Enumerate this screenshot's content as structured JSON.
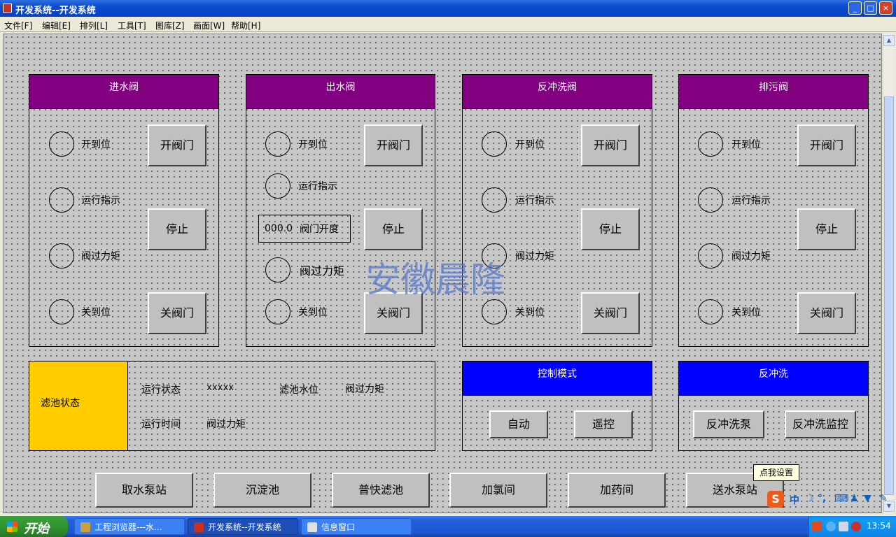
{
  "window": {
    "title": "开发系统--开发系统",
    "min": "_",
    "max": "□",
    "close": "×"
  },
  "menu": [
    "文件[F]",
    "编辑[E]",
    "排列[L]",
    "工具[T]",
    "图库[Z]",
    "画面[W]",
    "帮助[H]"
  ],
  "watermark": "安徽晨隆",
  "panels": [
    {
      "title": "进水阀",
      "open_ind": "开到位",
      "run_ind": "运行指示",
      "torque": "阀过力矩",
      "closed_ind": "关到位",
      "open_btn": "开阀门",
      "stop_btn": "停止",
      "close_btn": "关阀门"
    },
    {
      "title": "出水阀",
      "open_ind": "开到位",
      "run_ind": "运行指示",
      "opening_value": "000.0",
      "opening_label": "阀门开度",
      "torque": "阀过力矩",
      "closed_ind": "关到位",
      "open_btn": "开阀门",
      "stop_btn": "停止",
      "close_btn": "关阀门"
    },
    {
      "title": "反冲洗阀",
      "open_ind": "开到位",
      "run_ind": "运行指示",
      "torque": "阀过力矩",
      "closed_ind": "关到位",
      "open_btn": "开阀门",
      "stop_btn": "停止",
      "close_btn": "关阀门"
    },
    {
      "title": "排污阀",
      "open_ind": "开到位",
      "run_ind": "运行指示",
      "torque": "阀过力矩",
      "closed_ind": "关到位",
      "open_btn": "开阀门",
      "stop_btn": "停止",
      "close_btn": "关阀门"
    }
  ],
  "filter": {
    "title": "滤池状态",
    "run_state_label": "运行状态",
    "run_state_value": "xxxxx",
    "level_label": "滤池水位",
    "level_value": "阀过力矩",
    "run_time_label": "运行时间",
    "run_time_value": "阀过力矩"
  },
  "control_mode": {
    "title": "控制模式",
    "auto": "自动",
    "remote": "遥控"
  },
  "backwash": {
    "title": "反冲洗",
    "pump": "反冲洗泵",
    "monitor": "反冲洗监控"
  },
  "nav": [
    "取水泵站",
    "沉淀池",
    "普快滤池",
    "加氯间",
    "加药间",
    "送水泵站"
  ],
  "tooltip": "点我设置",
  "ime": {
    "logo": "S",
    "mode": "中",
    "moon": "☽",
    "punct": "°,",
    "keyboard": "⌨",
    "user": "♟",
    "shirt": "▼",
    "tool": "✎"
  },
  "taskbar": {
    "start": "开始",
    "tasks": [
      "工程浏览器---水...",
      "开发系统--开发系统",
      "信息窗口"
    ],
    "clock": "13:54"
  },
  "colors": {
    "panel_header": "#800080",
    "blue_header": "#0000ff",
    "filter_status": "#ffcc00",
    "canvas": "#c8c8c8"
  }
}
